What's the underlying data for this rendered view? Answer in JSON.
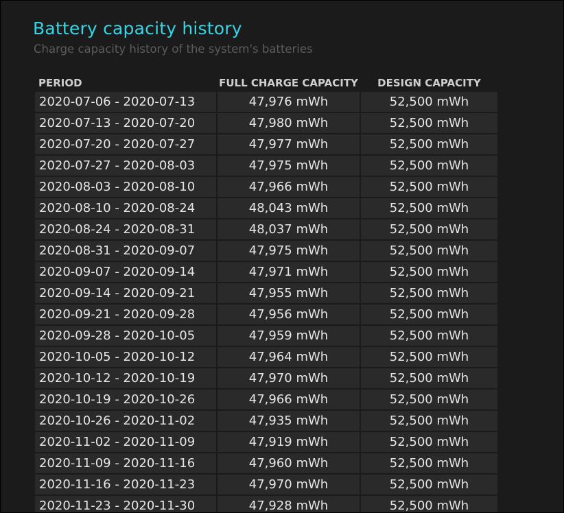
{
  "page": {
    "title": "Battery capacity history",
    "subtitle": "Charge capacity history of the system's batteries"
  },
  "table": {
    "headers": {
      "period": "PERIOD",
      "full_charge_capacity": "FULL CHARGE CAPACITY",
      "design_capacity": "DESIGN CAPACITY"
    },
    "rows": [
      {
        "period": "2020-07-06 - 2020-07-13",
        "full": "47,976 mWh",
        "design": "52,500 mWh"
      },
      {
        "period": "2020-07-13 - 2020-07-20",
        "full": "47,980 mWh",
        "design": "52,500 mWh"
      },
      {
        "period": "2020-07-20 - 2020-07-27",
        "full": "47,977 mWh",
        "design": "52,500 mWh"
      },
      {
        "period": "2020-07-27 - 2020-08-03",
        "full": "47,975 mWh",
        "design": "52,500 mWh"
      },
      {
        "period": "2020-08-03 - 2020-08-10",
        "full": "47,966 mWh",
        "design": "52,500 mWh"
      },
      {
        "period": "2020-08-10 - 2020-08-24",
        "full": "48,043 mWh",
        "design": "52,500 mWh"
      },
      {
        "period": "2020-08-24 - 2020-08-31",
        "full": "48,037 mWh",
        "design": "52,500 mWh"
      },
      {
        "period": "2020-08-31 - 2020-09-07",
        "full": "47,975 mWh",
        "design": "52,500 mWh"
      },
      {
        "period": "2020-09-07 - 2020-09-14",
        "full": "47,971 mWh",
        "design": "52,500 mWh"
      },
      {
        "period": "2020-09-14 - 2020-09-21",
        "full": "47,955 mWh",
        "design": "52,500 mWh"
      },
      {
        "period": "2020-09-21 - 2020-09-28",
        "full": "47,956 mWh",
        "design": "52,500 mWh"
      },
      {
        "period": "2020-09-28 - 2020-10-05",
        "full": "47,959 mWh",
        "design": "52,500 mWh"
      },
      {
        "period": "2020-10-05 - 2020-10-12",
        "full": "47,964 mWh",
        "design": "52,500 mWh"
      },
      {
        "period": "2020-10-12 - 2020-10-19",
        "full": "47,970 mWh",
        "design": "52,500 mWh"
      },
      {
        "period": "2020-10-19 - 2020-10-26",
        "full": "47,966 mWh",
        "design": "52,500 mWh"
      },
      {
        "period": "2020-10-26 - 2020-11-02",
        "full": "47,935 mWh",
        "design": "52,500 mWh"
      },
      {
        "period": "2020-11-02 - 2020-11-09",
        "full": "47,919 mWh",
        "design": "52,500 mWh"
      },
      {
        "period": "2020-11-09 - 2020-11-16",
        "full": "47,960 mWh",
        "design": "52,500 mWh"
      },
      {
        "period": "2020-11-16 - 2020-11-23",
        "full": "47,970 mWh",
        "design": "52,500 mWh"
      },
      {
        "period": "2020-11-23 - 2020-11-30",
        "full": "47,928 mWh",
        "design": "52,500 mWh"
      }
    ]
  }
}
